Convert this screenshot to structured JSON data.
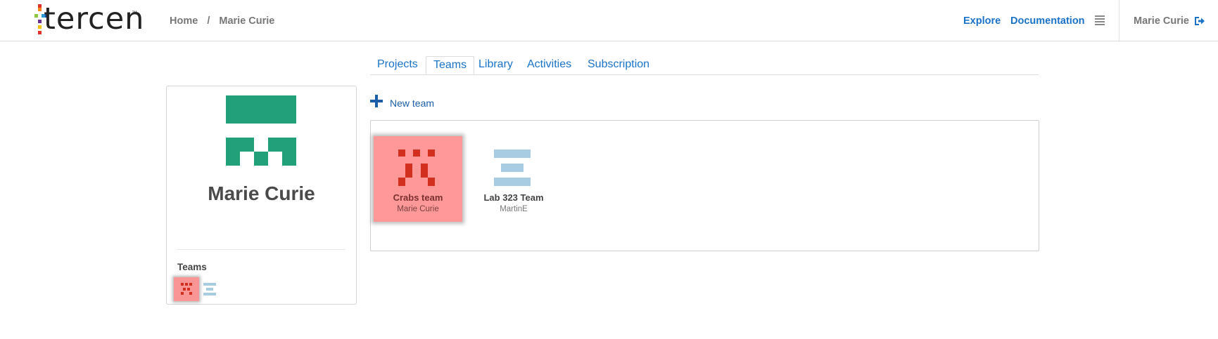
{
  "header": {
    "logo_text": "tercen",
    "logo_tm": "™",
    "breadcrumb": [
      "Home",
      "/",
      "Marie Curie"
    ],
    "nav": [
      "Explore",
      "Documentation"
    ],
    "menu_icon": "list-menu-icon",
    "user_name": "Marie Curie",
    "logout_icon": "sign-out-icon"
  },
  "tabs": [
    {
      "label": "Projects",
      "active": false
    },
    {
      "label": "Teams",
      "active": true
    },
    {
      "label": "Library",
      "active": false
    },
    {
      "label": "Activities",
      "active": false
    },
    {
      "label": "Subscription",
      "active": false
    }
  ],
  "profile": {
    "name": "Marie Curie",
    "avatar_color": "#21a07a",
    "teams_label": "Teams"
  },
  "new_team": {
    "label": "New team",
    "icon": "plus-icon"
  },
  "teams": [
    {
      "name": "Crabs team",
      "owner": "Marie Curie",
      "selected": true,
      "bg_color": "#ff9999",
      "icon_color": "#d32f1e"
    },
    {
      "name": "Lab 323 Team",
      "owner": "MartinE",
      "selected": false,
      "icon_color": "#a8cde3"
    }
  ],
  "colors": {
    "link": "#1a73c8",
    "text": "#555555"
  }
}
